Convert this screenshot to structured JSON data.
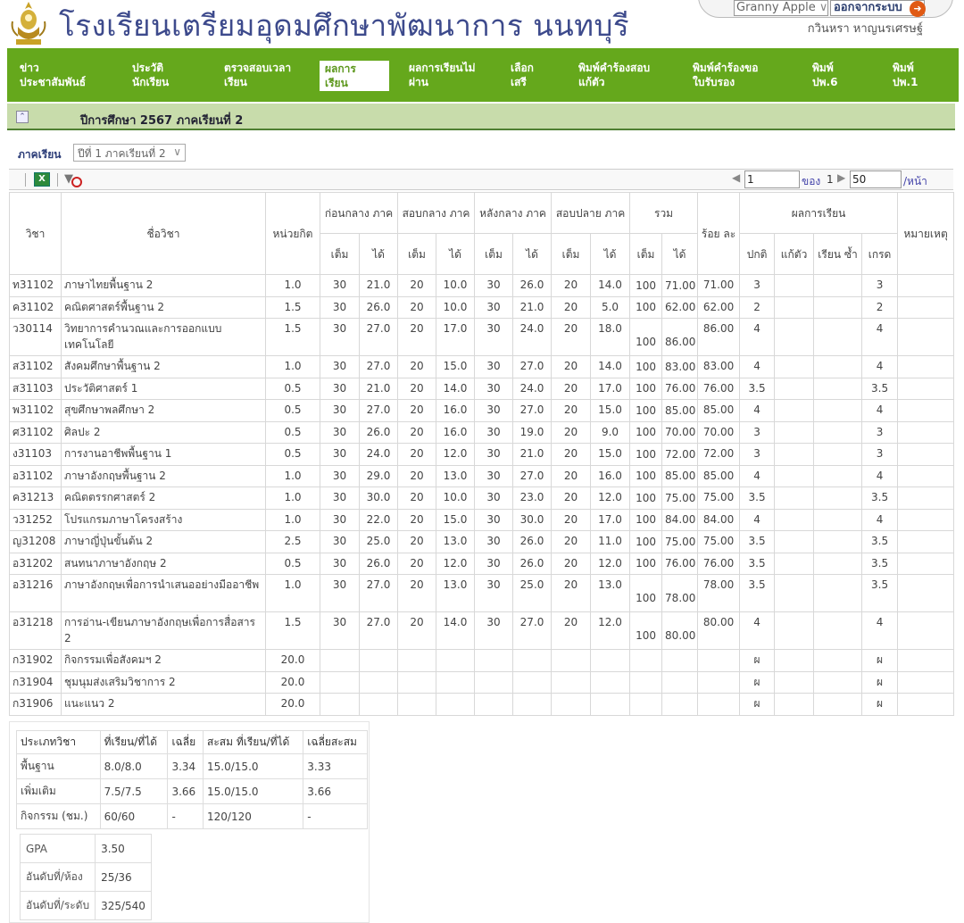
{
  "header": {
    "school_name": "โรงเรียนเตรียมอุดมศึกษาพัฒนาการ นนทบุรี",
    "user_select": "Granny Apple",
    "logout_label": "ออกจากระบบ",
    "username": "กวินหรา หาญนรเศรษฐ์"
  },
  "nav": [
    {
      "line1": "ข่าว",
      "line2": "ประชาสัมพันธ์"
    },
    {
      "line1": "ประวัติ",
      "line2": "นักเรียน"
    },
    {
      "line1": "ตรวจสอบเวลา",
      "line2": "เรียน"
    },
    {
      "line1": "ผลการ",
      "line2": "เรียน"
    },
    {
      "line1": "ผลการเรียนไม่",
      "line2": "ผ่าน"
    },
    {
      "line1": "เลือก",
      "line2": "เสรี"
    },
    {
      "line1": "พิมพ์คำร้องสอบ",
      "line2": "แก้ตัว"
    },
    {
      "line1": "พิมพ์คำร้องขอ",
      "line2": "ใบรับรอง"
    },
    {
      "line1": "พิมพ์",
      "line2": "ปพ.6"
    },
    {
      "line1": "พิมพ์",
      "line2": "ปพ.1"
    }
  ],
  "section_title": "ปีการศึกษา 2567 ภาคเรียนที่ 2",
  "term_label": "ภาคเรียน",
  "term_value": "ปีที่ 1 ภาคเรียนที่ 2",
  "pager": {
    "page": "1",
    "of_label": "ของ",
    "total": "1",
    "per_page": "50",
    "per_page_label": "/หน้า"
  },
  "table": {
    "h_code": "วิชา",
    "h_name": "ชื่อวิชา",
    "h_credit": "หน่วยกิต",
    "h_pre": "ก่อนกลาง ภาค",
    "h_mid": "สอบกลาง ภาค",
    "h_post": "หลังกลาง ภาค",
    "h_final": "สอบปลาย ภาค",
    "h_total": "รวม",
    "h_percent": "ร้อย ละ",
    "h_result": "ผลการเรียน",
    "h_note": "หมายเหตุ",
    "h_full": "เต็ม",
    "h_got": "ได้",
    "h_normal": "ปกติ",
    "h_retest": "แก้ตัว",
    "h_repeat": "เรียน ซ้ำ",
    "h_grade": "เกรด",
    "rows": [
      {
        "code": "ท31102",
        "name": "ภาษาไทยพื้นฐาน 2",
        "credit": "1.0",
        "f1": "30",
        "g1": "21.0",
        "f2": "20",
        "g2": "10.0",
        "f3": "30",
        "g3": "26.0",
        "f4": "20",
        "g4": "14.0",
        "tf": "100",
        "tg": "71.00",
        "pct": "71.00",
        "normal": "3",
        "retest": "",
        "repeat": "",
        "grade": "3",
        "note": ""
      },
      {
        "code": "ค31102",
        "name": "คณิตศาสตร์พื้นฐาน 2",
        "credit": "1.5",
        "f1": "30",
        "g1": "26.0",
        "f2": "20",
        "g2": "10.0",
        "f3": "30",
        "g3": "21.0",
        "f4": "20",
        "g4": "5.0",
        "tf": "100",
        "tg": "62.00",
        "pct": "62.00",
        "normal": "2",
        "retest": "",
        "repeat": "",
        "grade": "2",
        "note": ""
      },
      {
        "code": "ว30114",
        "name": "วิทยาการคำนวณและการออกแบบเทคโนโลยี",
        "credit": "1.5",
        "f1": "30",
        "g1": "27.0",
        "f2": "20",
        "g2": "17.0",
        "f3": "30",
        "g3": "24.0",
        "f4": "20",
        "g4": "18.0",
        "tf": "100",
        "tg": "86.00",
        "pct": "86.00",
        "normal": "4",
        "retest": "",
        "repeat": "",
        "grade": "4",
        "note": ""
      },
      {
        "code": "ส31102",
        "name": "สังคมศึกษาพื้นฐาน 2",
        "credit": "1.0",
        "f1": "30",
        "g1": "27.0",
        "f2": "20",
        "g2": "15.0",
        "f3": "30",
        "g3": "27.0",
        "f4": "20",
        "g4": "14.0",
        "tf": "100",
        "tg": "83.00",
        "pct": "83.00",
        "normal": "4",
        "retest": "",
        "repeat": "",
        "grade": "4",
        "note": ""
      },
      {
        "code": "ส31103",
        "name": "ประวัติศาสตร์ 1",
        "credit": "0.5",
        "f1": "30",
        "g1": "21.0",
        "f2": "20",
        "g2": "14.0",
        "f3": "30",
        "g3": "24.0",
        "f4": "20",
        "g4": "17.0",
        "tf": "100",
        "tg": "76.00",
        "pct": "76.00",
        "normal": "3.5",
        "retest": "",
        "repeat": "",
        "grade": "3.5",
        "note": ""
      },
      {
        "code": "พ31102",
        "name": "สุขศึกษาพลศึกษา 2",
        "credit": "0.5",
        "f1": "30",
        "g1": "27.0",
        "f2": "20",
        "g2": "16.0",
        "f3": "30",
        "g3": "27.0",
        "f4": "20",
        "g4": "15.0",
        "tf": "100",
        "tg": "85.00",
        "pct": "85.00",
        "normal": "4",
        "retest": "",
        "repeat": "",
        "grade": "4",
        "note": ""
      },
      {
        "code": "ศ31102",
        "name": "ศิลปะ 2",
        "credit": "0.5",
        "f1": "30",
        "g1": "26.0",
        "f2": "20",
        "g2": "16.0",
        "f3": "30",
        "g3": "19.0",
        "f4": "20",
        "g4": "9.0",
        "tf": "100",
        "tg": "70.00",
        "pct": "70.00",
        "normal": "3",
        "retest": "",
        "repeat": "",
        "grade": "3",
        "note": ""
      },
      {
        "code": "ง31103",
        "name": "การงานอาชีพพื้นฐาน 1",
        "credit": "0.5",
        "f1": "30",
        "g1": "24.0",
        "f2": "20",
        "g2": "12.0",
        "f3": "30",
        "g3": "21.0",
        "f4": "20",
        "g4": "15.0",
        "tf": "100",
        "tg": "72.00",
        "pct": "72.00",
        "normal": "3",
        "retest": "",
        "repeat": "",
        "grade": "3",
        "note": ""
      },
      {
        "code": "อ31102",
        "name": "ภาษาอังกฤษพื้นฐาน 2",
        "credit": "1.0",
        "f1": "30",
        "g1": "29.0",
        "f2": "20",
        "g2": "13.0",
        "f3": "30",
        "g3": "27.0",
        "f4": "20",
        "g4": "16.0",
        "tf": "100",
        "tg": "85.00",
        "pct": "85.00",
        "normal": "4",
        "retest": "",
        "repeat": "",
        "grade": "4",
        "note": ""
      },
      {
        "code": "ค31213",
        "name": "คณิตตรรกศาสตร์ 2",
        "credit": "1.0",
        "f1": "30",
        "g1": "30.0",
        "f2": "20",
        "g2": "10.0",
        "f3": "30",
        "g3": "23.0",
        "f4": "20",
        "g4": "12.0",
        "tf": "100",
        "tg": "75.00",
        "pct": "75.00",
        "normal": "3.5",
        "retest": "",
        "repeat": "",
        "grade": "3.5",
        "note": ""
      },
      {
        "code": "ว31252",
        "name": "โปรแกรมภาษาโครงสร้าง",
        "credit": "1.0",
        "f1": "30",
        "g1": "22.0",
        "f2": "20",
        "g2": "15.0",
        "f3": "30",
        "g3": "30.0",
        "f4": "20",
        "g4": "17.0",
        "tf": "100",
        "tg": "84.00",
        "pct": "84.00",
        "normal": "4",
        "retest": "",
        "repeat": "",
        "grade": "4",
        "note": ""
      },
      {
        "code": "ญ31208",
        "name": "ภาษาญี่ปุ่นขั้นต้น 2",
        "credit": "2.5",
        "f1": "30",
        "g1": "25.0",
        "f2": "20",
        "g2": "13.0",
        "f3": "30",
        "g3": "26.0",
        "f4": "20",
        "g4": "11.0",
        "tf": "100",
        "tg": "75.00",
        "pct": "75.00",
        "normal": "3.5",
        "retest": "",
        "repeat": "",
        "grade": "3.5",
        "note": ""
      },
      {
        "code": "อ31202",
        "name": "สนทนาภาษาอังกฤษ 2",
        "credit": "0.5",
        "f1": "30",
        "g1": "26.0",
        "f2": "20",
        "g2": "12.0",
        "f3": "30",
        "g3": "26.0",
        "f4": "20",
        "g4": "12.0",
        "tf": "100",
        "tg": "76.00",
        "pct": "76.00",
        "normal": "3.5",
        "retest": "",
        "repeat": "",
        "grade": "3.5",
        "note": ""
      },
      {
        "code": "อ31216",
        "name": "ภาษาอังกฤษเพื่อการนำเสนออย่างมืออาชีพ",
        "credit": "1.0",
        "f1": "30",
        "g1": "27.0",
        "f2": "20",
        "g2": "13.0",
        "f3": "30",
        "g3": "25.0",
        "f4": "20",
        "g4": "13.0",
        "tf": "100",
        "tg": "78.00",
        "pct": "78.00",
        "normal": "3.5",
        "retest": "",
        "repeat": "",
        "grade": "3.5",
        "note": ""
      },
      {
        "code": "อ31218",
        "name": "การอ่าน-เขียนภาษาอังกฤษเพื่อการสื่อสาร 2",
        "credit": "1.5",
        "f1": "30",
        "g1": "27.0",
        "f2": "20",
        "g2": "14.0",
        "f3": "30",
        "g3": "27.0",
        "f4": "20",
        "g4": "12.0",
        "tf": "100",
        "tg": "80.00",
        "pct": "80.00",
        "normal": "4",
        "retest": "",
        "repeat": "",
        "grade": "4",
        "note": ""
      },
      {
        "code": "ก31902",
        "name": "กิจกรรมเพื่อสังคมฯ 2",
        "credit": "20.0",
        "f1": "",
        "g1": "",
        "f2": "",
        "g2": "",
        "f3": "",
        "g3": "",
        "f4": "",
        "g4": "",
        "tf": "",
        "tg": "",
        "pct": "",
        "normal": "ผ",
        "retest": "",
        "repeat": "",
        "grade": "ผ",
        "note": ""
      },
      {
        "code": "ก31904",
        "name": "ชุมนุมส่งเสริมวิชาการ 2",
        "credit": "20.0",
        "f1": "",
        "g1": "",
        "f2": "",
        "g2": "",
        "f3": "",
        "g3": "",
        "f4": "",
        "g4": "",
        "tf": "",
        "tg": "",
        "pct": "",
        "normal": "ผ",
        "retest": "",
        "repeat": "",
        "grade": "ผ",
        "note": ""
      },
      {
        "code": "ก31906",
        "name": "แนะแนว 2",
        "credit": "20.0",
        "f1": "",
        "g1": "",
        "f2": "",
        "g2": "",
        "f3": "",
        "g3": "",
        "f4": "",
        "g4": "",
        "tf": "",
        "tg": "",
        "pct": "",
        "normal": "ผ",
        "retest": "",
        "repeat": "",
        "grade": "ผ",
        "note": ""
      }
    ]
  },
  "summary": {
    "headers": [
      "ประเภทวิชา",
      "ที่เรียน/ที่ได้",
      "เฉลี่ย",
      "สะสม ที่เรียน/ที่ได้",
      "เฉลี่ยสะสม"
    ],
    "rows": [
      [
        "พื้นฐาน",
        "8.0/8.0",
        "3.34",
        "15.0/15.0",
        "3.33"
      ],
      [
        "เพิ่มเติม",
        "7.5/7.5",
        "3.66",
        "15.0/15.0",
        "3.66"
      ],
      [
        "กิจกรรม (ชม.)",
        "60/60",
        "-",
        "120/120",
        "-"
      ]
    ]
  },
  "gpa": [
    {
      "label": "GPA",
      "value": "3.50"
    },
    {
      "label": "อันดับที่/ห้อง",
      "value": "25/36"
    },
    {
      "label": "อันดับที่/ระดับ",
      "value": "325/540"
    }
  ],
  "colors": {
    "nav_green": "#65a81c",
    "bar_green": "#c8dcab",
    "title_blue": "#3d4a8c"
  }
}
